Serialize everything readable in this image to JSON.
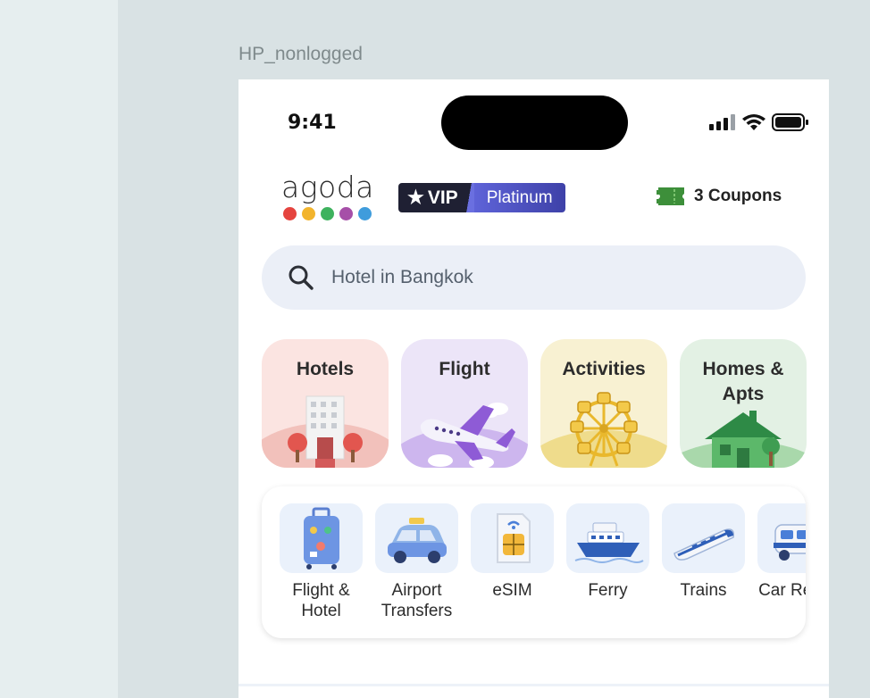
{
  "canvas": {
    "frame_label": "HP_nonlogged"
  },
  "status_bar": {
    "time": "9:41",
    "icons": [
      "signal-icon",
      "wifi-icon",
      "battery-icon"
    ]
  },
  "header": {
    "logo_text": "agoda",
    "logo_dot_colors": [
      "#e5443f",
      "#f2b42d",
      "#3eb25e",
      "#a64fa8",
      "#3f9cdc"
    ],
    "vip_label": "VIP",
    "vip_tier": "Platinum",
    "coupons_label": "3 Coupons"
  },
  "search": {
    "placeholder": "Hotel in Bangkok"
  },
  "categories": [
    {
      "label": "Hotels",
      "icon": "hotel-building-icon",
      "bg": "#fbe4e1"
    },
    {
      "label": "Flight",
      "icon": "airplane-icon",
      "bg": "#ece5f8"
    },
    {
      "label": "Activities",
      "icon": "ferris-wheel-icon",
      "bg": "#f8f1d2"
    },
    {
      "label": "Homes & Apts",
      "icon": "house-icon",
      "bg": "#e3f1e4"
    }
  ],
  "services": [
    {
      "label": "Flight & Hotel",
      "icon": "suitcase-icon"
    },
    {
      "label": "Airport Transfers",
      "icon": "taxi-icon"
    },
    {
      "label": "eSIM",
      "icon": "sim-card-icon"
    },
    {
      "label": "Ferry",
      "icon": "ferry-icon"
    },
    {
      "label": "Trains",
      "icon": "train-icon"
    },
    {
      "label": "Car Rental",
      "icon": "car-icon"
    }
  ],
  "colors": {
    "vip_dark": "#1f2033",
    "vip_accent": "#4b4fb5",
    "coupon_green": "#3d8f3a",
    "search_bg": "#ebeff7"
  }
}
